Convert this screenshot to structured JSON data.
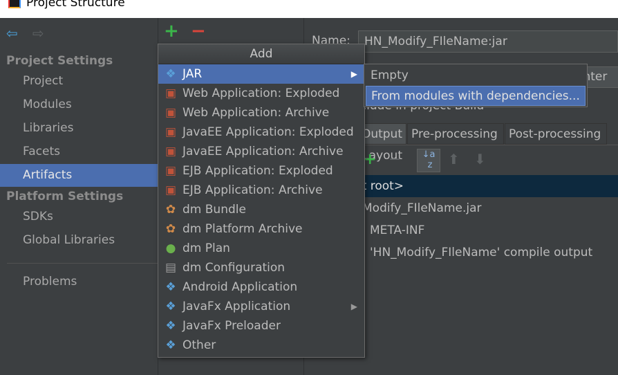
{
  "window": {
    "title": "Project Structure"
  },
  "sidebar": {
    "project_settings": "Project Settings",
    "items": [
      {
        "label": "Project"
      },
      {
        "label": "Modules"
      },
      {
        "label": "Libraries"
      },
      {
        "label": "Facets"
      },
      {
        "label": "Artifacts",
        "selected": true
      }
    ],
    "platform_settings": "Platform Settings",
    "platform_items": [
      {
        "label": "SDKs"
      },
      {
        "label": "Global Libraries"
      }
    ],
    "problems": "Problems"
  },
  "toolbar": {
    "add": "+",
    "remove": "−"
  },
  "details": {
    "name_label": "Name:",
    "name_value": "HN_Modify_FIleName:jar",
    "button_partial": "enter",
    "include_build": "Include in project Build",
    "tabs": [
      "Output Layout",
      "Pre-processing",
      "Post-processing"
    ],
    "tree": [
      "<output root>",
      "HN_Modify_FIleName.jar",
      "META-INF",
      "'HN_Modify_FIleName' compile output"
    ]
  },
  "menu": {
    "title": "Add",
    "items": [
      {
        "label": "JAR",
        "icon": "diamond",
        "color": "#5aa0d8",
        "submenu": true,
        "selected": true
      },
      {
        "label": "Web Application: Exploded",
        "icon": "web-app",
        "color": "#c0533a"
      },
      {
        "label": "Web Application: Archive",
        "icon": "web-app",
        "color": "#c0533a"
      },
      {
        "label": "JavaEE Application: Exploded",
        "icon": "javaee",
        "color": "#c0533a"
      },
      {
        "label": "JavaEE Application: Archive",
        "icon": "javaee",
        "color": "#c0533a"
      },
      {
        "label": "EJB Application: Exploded",
        "icon": "ejb",
        "color": "#c0533a"
      },
      {
        "label": "EJB Application: Archive",
        "icon": "ejb",
        "color": "#c0533a"
      },
      {
        "label": "dm Bundle",
        "icon": "bundle",
        "color": "#d08a4a"
      },
      {
        "label": "dm Platform Archive",
        "icon": "bundle",
        "color": "#d08a4a"
      },
      {
        "label": "dm Plan",
        "icon": "globe",
        "color": "#6ab04c"
      },
      {
        "label": "dm Configuration",
        "icon": "document",
        "color": "#9a9a9a"
      },
      {
        "label": "Android Application",
        "icon": "diamond",
        "color": "#5aa0d8"
      },
      {
        "label": "JavaFx Application",
        "icon": "diamond",
        "color": "#5aa0d8",
        "submenu": true
      },
      {
        "label": "JavaFx Preloader",
        "icon": "diamond",
        "color": "#5aa0d8"
      },
      {
        "label": "Other",
        "icon": "diamond",
        "color": "#5aa0d8"
      }
    ]
  },
  "submenu": {
    "items": [
      {
        "label": "Empty"
      },
      {
        "label": "From modules with dependencies...",
        "selected": true
      }
    ]
  }
}
